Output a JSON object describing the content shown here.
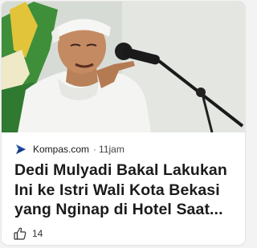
{
  "card": {
    "source": {
      "name": "Kompas.com",
      "separator": "·",
      "time": "11jam",
      "logo_icon": "kompas-logo-icon"
    },
    "headline": "Dedi Mulyadi Bakal Lakukan Ini ke Istri Wali Kota Bekasi yang Nginap di Hotel Saat...",
    "reactions": {
      "icon": "thumbs-up-icon",
      "count": "14"
    },
    "image": {
      "description_icon": "news-photo"
    }
  },
  "colors": {
    "card_bg": "#ffffff",
    "page_bg": "#f3f3f3",
    "headline_text": "#1b1b1b",
    "kompas_blue": "#1e4fa8"
  }
}
